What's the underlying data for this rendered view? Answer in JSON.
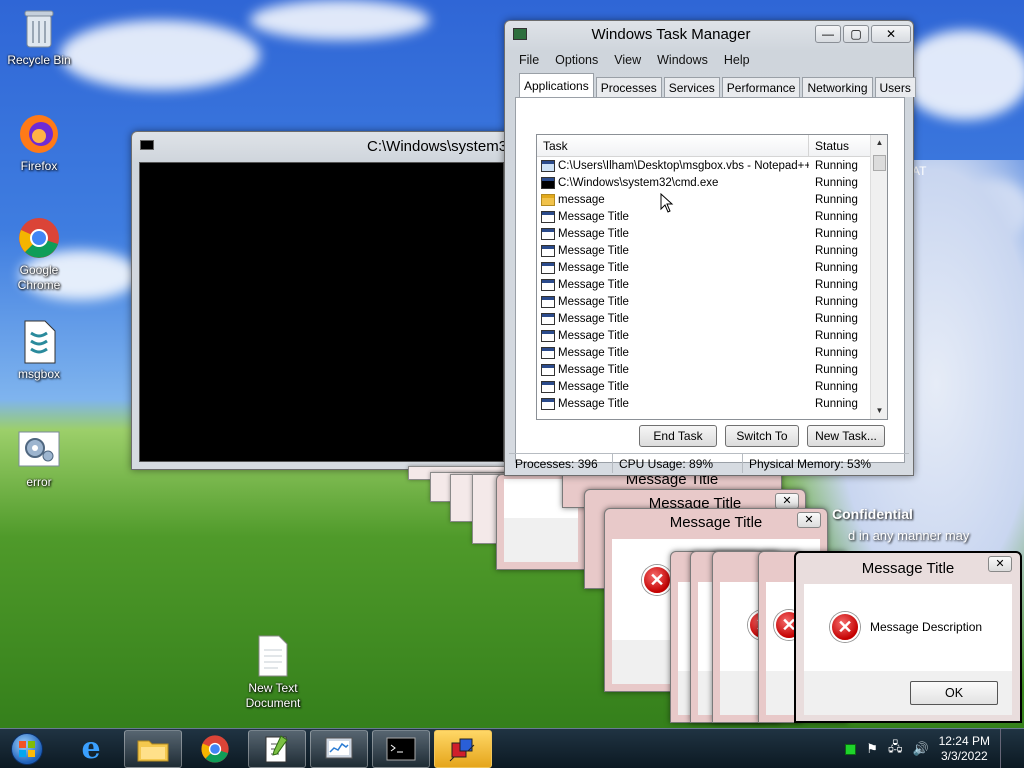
{
  "desktop": {
    "icons": [
      {
        "label": "Recycle Bin"
      },
      {
        "label": "Firefox"
      },
      {
        "label": "Google Chrome"
      },
      {
        "label": "msgbox"
      },
      {
        "label": "error"
      },
      {
        "label": "New Text Document"
      }
    ],
    "background_fragments": {
      "right_clip_1": "AT",
      "right_clip_2": "Confidential",
      "right_clip_3": "d in any manner may"
    }
  },
  "cmd_window": {
    "title": "C:\\Windows\\system3"
  },
  "task_manager": {
    "title": "Windows Task Manager",
    "menu": [
      "File",
      "Options",
      "View",
      "Windows",
      "Help"
    ],
    "tabs": [
      "Applications",
      "Processes",
      "Services",
      "Performance",
      "Networking",
      "Users"
    ],
    "active_tab": "Applications",
    "columns": {
      "task": "Task",
      "status": "Status"
    },
    "rows": [
      {
        "task": "C:\\Users\\Ilham\\Desktop\\msgbox.vbs - Notepad++",
        "status": "Running",
        "icon": "notepad-icon"
      },
      {
        "task": "C:\\Windows\\system32\\cmd.exe",
        "status": "Running",
        "icon": "cmd-icon"
      },
      {
        "task": "message",
        "status": "Running",
        "icon": "folder-icon"
      },
      {
        "task": "Message Title",
        "status": "Running",
        "icon": "window-icon"
      },
      {
        "task": "Message Title",
        "status": "Running",
        "icon": "window-icon"
      },
      {
        "task": "Message Title",
        "status": "Running",
        "icon": "window-icon"
      },
      {
        "task": "Message Title",
        "status": "Running",
        "icon": "window-icon"
      },
      {
        "task": "Message Title",
        "status": "Running",
        "icon": "window-icon"
      },
      {
        "task": "Message Title",
        "status": "Running",
        "icon": "window-icon"
      },
      {
        "task": "Message Title",
        "status": "Running",
        "icon": "window-icon"
      },
      {
        "task": "Message Title",
        "status": "Running",
        "icon": "window-icon"
      },
      {
        "task": "Message Title",
        "status": "Running",
        "icon": "window-icon"
      },
      {
        "task": "Message Title",
        "status": "Running",
        "icon": "window-icon"
      },
      {
        "task": "Message Title",
        "status": "Running",
        "icon": "window-icon"
      },
      {
        "task": "Message Title",
        "status": "Running",
        "icon": "window-icon"
      }
    ],
    "buttons": {
      "end_task": "End Task",
      "switch_to": "Switch To",
      "new_task": "New Task..."
    },
    "statusbar": {
      "processes": "Processes: 396",
      "cpu": "CPU Usage: 89%",
      "memory": "Physical Memory: 53%"
    }
  },
  "message_boxes": {
    "title": "Message Title",
    "description": "Message Description",
    "ok_label": "OK",
    "close_glyph": "✕",
    "error_glyph": "✕"
  },
  "taskbar": {
    "clock_time": "12:24 PM",
    "clock_date": "3/3/2022"
  },
  "colors": {
    "accent": "#2f66d6",
    "error_red": "#c40000",
    "taskbar": "#14233a"
  }
}
